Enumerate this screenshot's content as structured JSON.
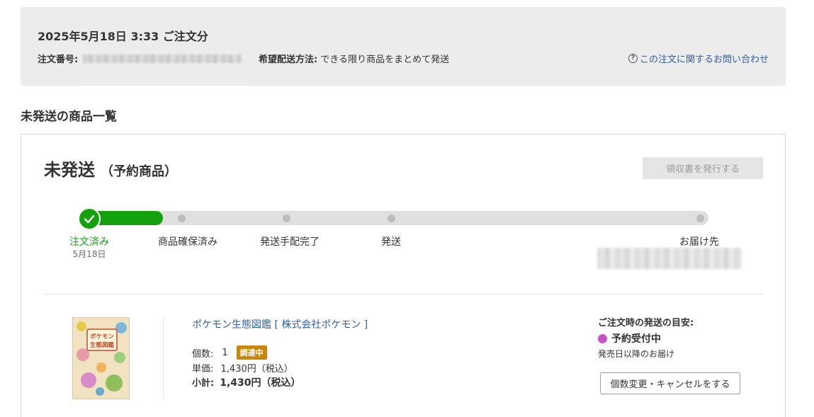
{
  "order": {
    "title": "2025年5月18日 3:33 ご注文分",
    "number_label": "注文番号:",
    "shipping_label": "希望配送方法:",
    "shipping_value": "できる限り商品をまとめて発送",
    "inquiry_link": "この注文に関するお問い合わせ"
  },
  "section_title": "未発送の商品一覧",
  "card": {
    "status": "未発送",
    "status_sub": "（予約商品）",
    "receipt_button": "領収書を発行する"
  },
  "progress": {
    "completed_steps": 1,
    "steps": [
      {
        "label": "注文済み",
        "date": "5月18日",
        "done": true
      },
      {
        "label": "商品確保済み"
      },
      {
        "label": "発送手配完了"
      },
      {
        "label": "発送"
      },
      {
        "label": "お届け先"
      }
    ]
  },
  "item": {
    "name": "ポケモン生態図鑑 [ 株式会社ポケモン ]",
    "cover_text": "ポケモン生態図鑑",
    "qty_label": "個数:",
    "qty_value": "1",
    "badge": "調達中",
    "unit_label": "単価:",
    "unit_value": "1,430円（税込）",
    "subtotal_label": "小計:",
    "subtotal_value": "1,430円（税込）"
  },
  "eta": {
    "label": "ご注文時の発送の目安:",
    "status": "予約受付中",
    "note": "発売日以降のお届け",
    "change_button": "個数変更・キャンセルをする"
  },
  "colors": {
    "progress_green": "#13a10e",
    "link_blue": "#2d5fa6",
    "badge_orange": "#c8860c",
    "status_purple": "#c653c6"
  }
}
